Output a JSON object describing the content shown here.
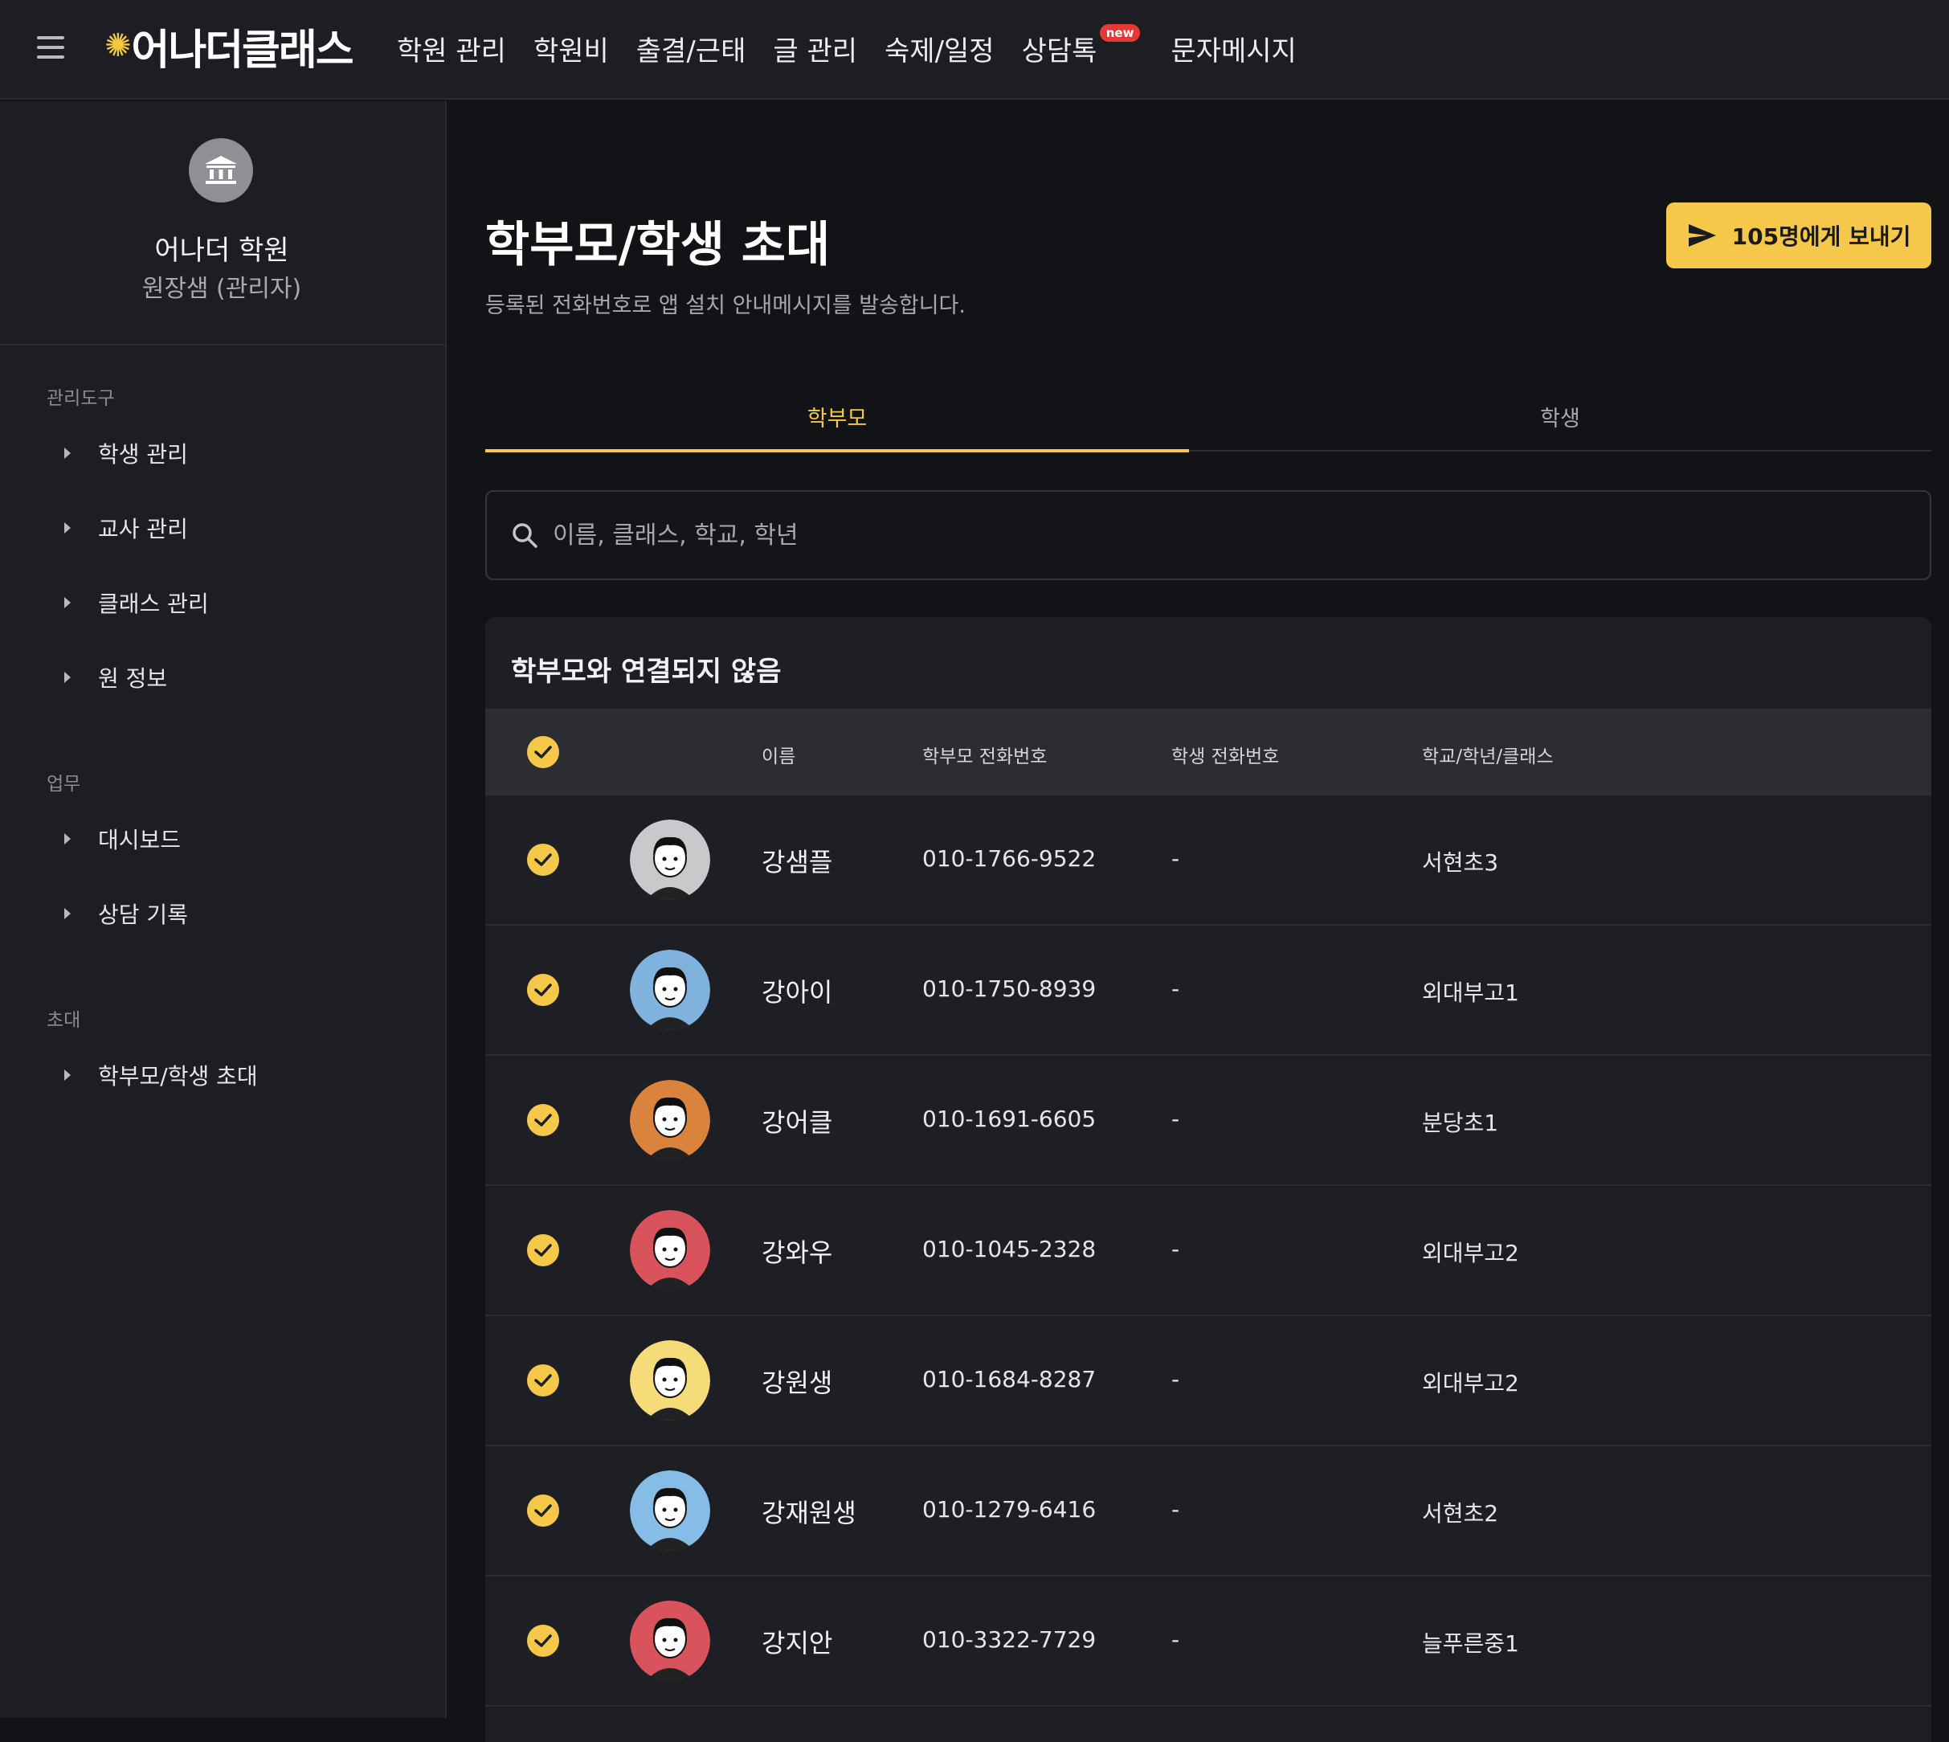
{
  "header": {
    "logo_text": "어나더클래스",
    "nav": [
      {
        "label": "학원 관리"
      },
      {
        "label": "학원비"
      },
      {
        "label": "출결/근태"
      },
      {
        "label": "글 관리"
      },
      {
        "label": "숙제/일정"
      },
      {
        "label": "상담톡",
        "badge": "new"
      },
      {
        "label": "문자메시지"
      }
    ]
  },
  "sidebar": {
    "academy_name": "어나더 학원",
    "user_role": "원장샘 (관리자)",
    "sections": [
      {
        "label": "관리도구",
        "items": [
          "학생 관리",
          "교사 관리",
          "클래스 관리",
          "원 정보"
        ]
      },
      {
        "label": "업무",
        "items": [
          "대시보드",
          "상담 기록"
        ]
      },
      {
        "label": "초대",
        "items": [
          "학부모/학생 초대"
        ]
      }
    ]
  },
  "main": {
    "title": "학부모/학생 초대",
    "subtitle": "등록된 전화번호로 앱 설치 안내메시지를 발송합니다.",
    "send_button": "105명에게 보내기",
    "tabs": [
      "학부모",
      "학생"
    ],
    "active_tab": "학부모",
    "search_placeholder": "이름, 클래스, 학교, 학년",
    "card_title": "학부모와 연결되지 않음",
    "columns": [
      "이름",
      "학부모 전화번호",
      "학생 전화번호",
      "학교/학년/클래스"
    ],
    "rows": [
      {
        "name": "강샘플",
        "parent_phone": "010-1766-9522",
        "student_phone": "-",
        "school": "서현초3",
        "avatar_bg": "#c9c9cc"
      },
      {
        "name": "강아이",
        "parent_phone": "010-1750-8939",
        "student_phone": "-",
        "school": "외대부고1",
        "avatar_bg": "#7fb2dc"
      },
      {
        "name": "강어클",
        "parent_phone": "010-1691-6605",
        "student_phone": "-",
        "school": "분당초1",
        "avatar_bg": "#d9833c"
      },
      {
        "name": "강와우",
        "parent_phone": "010-1045-2328",
        "student_phone": "-",
        "school": "외대부고2",
        "avatar_bg": "#d9535c"
      },
      {
        "name": "강원생",
        "parent_phone": "010-1684-8287",
        "student_phone": "-",
        "school": "외대부고2",
        "avatar_bg": "#f5dc78"
      },
      {
        "name": "강재원생",
        "parent_phone": "010-1279-6416",
        "student_phone": "-",
        "school": "서현초2",
        "avatar_bg": "#86bde6"
      },
      {
        "name": "강지안",
        "parent_phone": "010-3322-7729",
        "student_phone": "-",
        "school": "늘푸른중1",
        "avatar_bg": "#d9535c"
      }
    ]
  },
  "colors": {
    "accent": "#f5c84a",
    "badge": "#e53935"
  }
}
